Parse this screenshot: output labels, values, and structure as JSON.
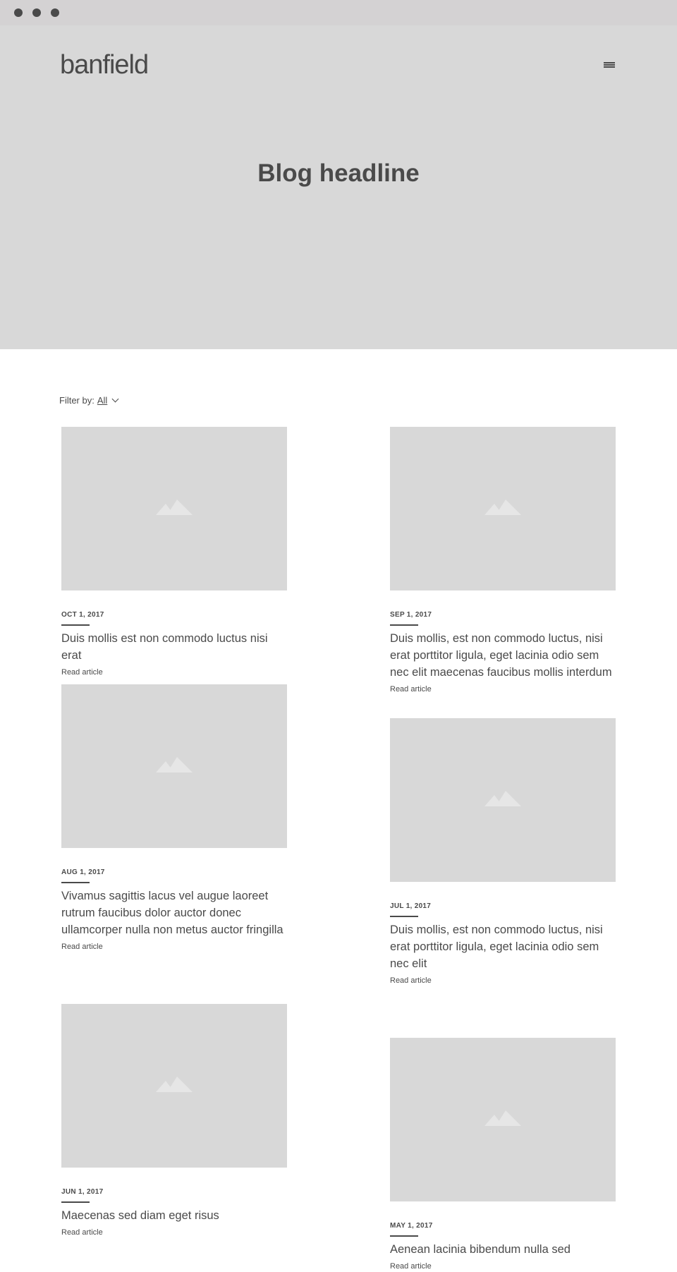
{
  "header": {
    "logo": "banfield",
    "hero_title": "Blog headline"
  },
  "filter": {
    "label": "Filter by:",
    "value": "All"
  },
  "articles": [
    {
      "date": "OCT 1, 2017",
      "title": "Duis mollis est non commodo luctus nisi erat",
      "link": "Read article"
    },
    {
      "date": "SEP 1, 2017",
      "title": "Duis mollis, est non commodo luctus, nisi erat porttitor ligula, eget lacinia odio sem nec elit maecenas faucibus mollis interdum",
      "link": "Read article"
    },
    {
      "date": "AUG 1, 2017",
      "title": "Vivamus sagittis lacus vel augue laoreet rutrum faucibus dolor auctor donec ullamcorper nulla non metus auctor fringilla",
      "link": "Read article"
    },
    {
      "date": "JUL 1, 2017",
      "title": "Duis mollis, est non commodo luctus, nisi erat porttitor ligula, eget lacinia odio sem nec elit",
      "link": "Read article"
    },
    {
      "date": "JUN 1, 2017",
      "title": "Maecenas sed diam eget risus",
      "link": "Read article"
    },
    {
      "date": "MAY 1, 2017",
      "title": "Aenean lacinia bibendum nulla sed",
      "link": "Read article"
    }
  ],
  "colors": {
    "chrome": "#d4d2d3",
    "placeholder": "#d8d8d8",
    "text": "#4a4a4a"
  }
}
